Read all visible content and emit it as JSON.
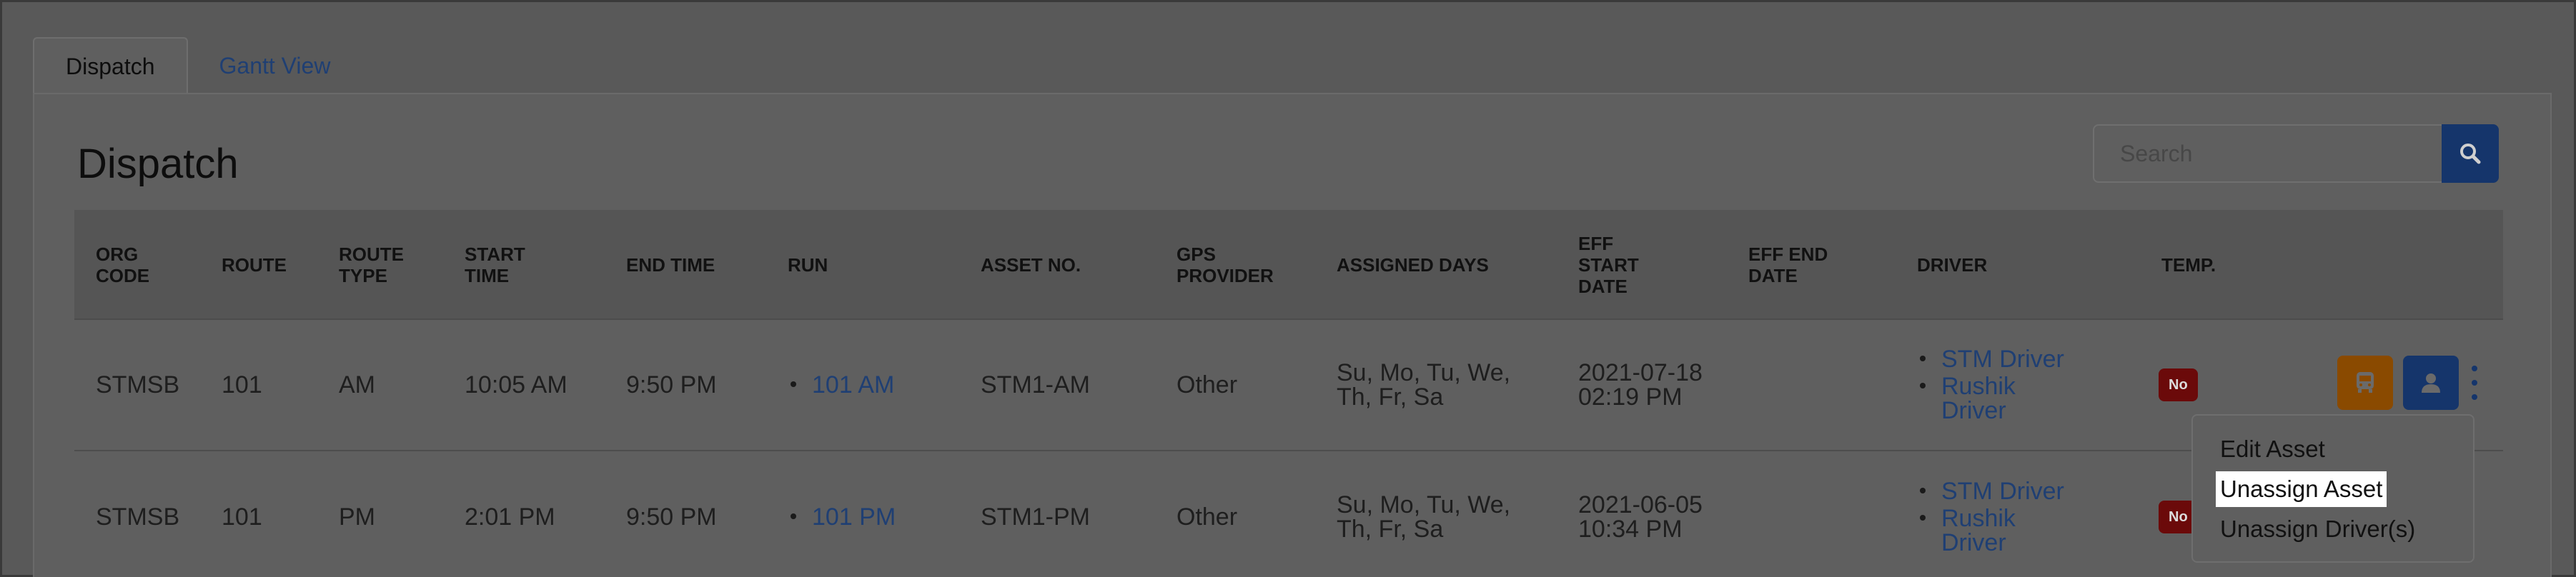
{
  "tabs": [
    {
      "label": "Dispatch",
      "active": true
    },
    {
      "label": "Gantt View",
      "active": false
    }
  ],
  "page_title": "Dispatch",
  "search": {
    "placeholder": "Search",
    "value": ""
  },
  "table": {
    "headers": {
      "org_code": "ORG CODE",
      "route": "ROUTE",
      "route_type": "ROUTE TYPE",
      "start_time": "START TIME",
      "end_time": "END TIME",
      "run": "RUN",
      "asset_no": "ASSET NO.",
      "gps_provider": "GPS PROVIDER",
      "assigned_days": "ASSIGNED DAYS",
      "eff_start_date": "EFF START DATE",
      "eff_end_date": "EFF END DATE",
      "driver": "DRIVER",
      "temp": "TEMP."
    },
    "rows": [
      {
        "org_code": "STMSB",
        "route": "101",
        "route_type": "AM",
        "start_time": "10:05 AM",
        "end_time": "9:50 PM",
        "run": "101 AM",
        "asset_no": "STM1-AM",
        "gps_provider": "Other",
        "assigned_days": "Su, Mo, Tu, We, Th, Fr, Sa",
        "eff_start_date": "2021-07-18 02:19 PM",
        "eff_end_date": "",
        "drivers": [
          "STM Driver",
          "Rushik Driver"
        ],
        "temp": "No"
      },
      {
        "org_code": "STMSB",
        "route": "101",
        "route_type": "PM",
        "start_time": "2:01 PM",
        "end_time": "9:50 PM",
        "run": "101 PM",
        "asset_no": "STM1-PM",
        "gps_provider": "Other",
        "assigned_days": "Su, Mo, Tu, We, Th, Fr, Sa",
        "eff_start_date": "2021-06-05 10:34 PM",
        "eff_end_date": "",
        "drivers": [
          "STM Driver",
          "Rushik Driver"
        ],
        "temp": "No"
      }
    ]
  },
  "row_actions": {
    "asset_icon": "bus-icon",
    "driver_icon": "user-icon",
    "more_icon": "kebab-icon"
  },
  "context_menu": {
    "items": [
      {
        "label": "Edit Asset",
        "highlighted": false
      },
      {
        "label": "Unassign Asset",
        "highlighted": true
      },
      {
        "label": "Unassign Driver(s)",
        "highlighted": false
      }
    ]
  },
  "colors": {
    "link": "#1f3f73",
    "primary_button": "#15356b",
    "asset_button": "#8a4a00",
    "temp_badge": "#6b0a0a",
    "overlay": "#5c5c5c"
  }
}
